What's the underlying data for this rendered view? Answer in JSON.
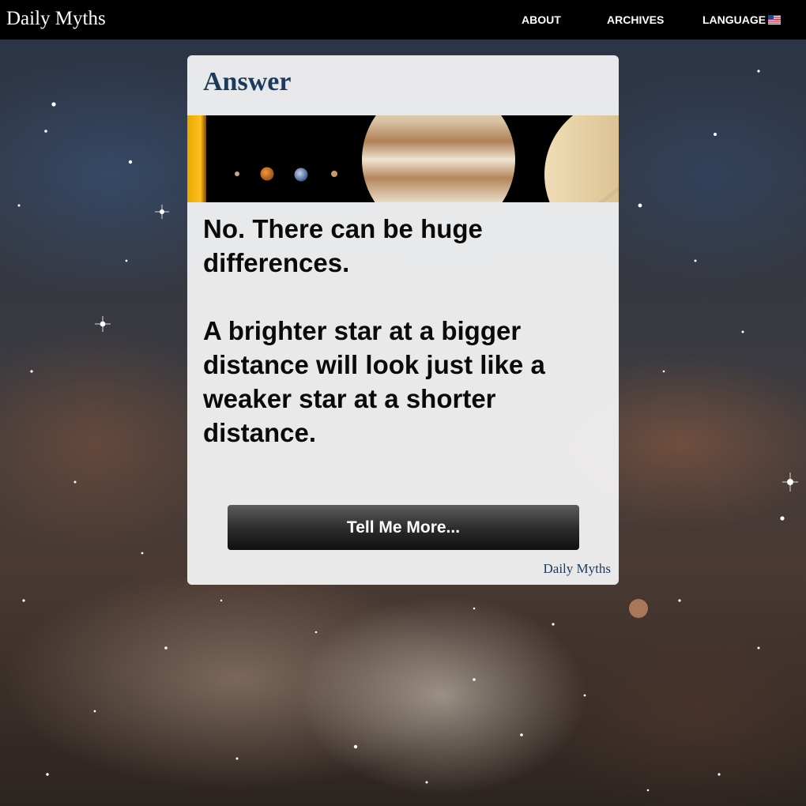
{
  "header": {
    "brand": "Daily Myths",
    "nav": {
      "about": "ABOUT",
      "archives": "ARCHIVES",
      "language": "LANGUAGE"
    },
    "language_flag_icon": "us-flag-icon"
  },
  "card": {
    "title": "Answer",
    "banner_image": "solar-system-planets",
    "answer_short": "No. There can be huge differences.",
    "answer_detail": "A brighter star at a bigger distance will look just like a weaker star at a shorter distance.",
    "more_button_label": "Tell Me More...",
    "footer_brand": "Daily Myths"
  },
  "colors": {
    "topbar": "#000000",
    "title_text": "#1b3a5c",
    "body_text": "#0a0a0a",
    "button_dark": "#1a1a1a"
  }
}
